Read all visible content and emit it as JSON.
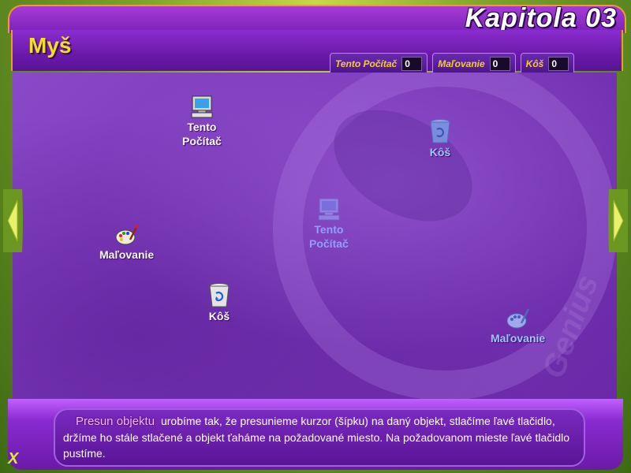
{
  "header": {
    "chapter_title": "Kapitola 03",
    "section_title": "Myš"
  },
  "counters": [
    {
      "label": "Tento Počítač",
      "value": "0"
    },
    {
      "label": "Maľovanie",
      "value": "0"
    },
    {
      "label": "Kôš",
      "value": "0"
    }
  ],
  "workspace": {
    "items": [
      {
        "name": "Tento Počítač",
        "line1": "Tento",
        "line2": "Počítač",
        "icon": "computer-icon"
      },
      {
        "name": "Kôš",
        "label": "Kôš",
        "icon": "recycle-bin-icon"
      },
      {
        "name": "Maľovanie",
        "label": "Maľovanie",
        "icon": "palette-icon"
      },
      {
        "name": "Tento Počítač (target)",
        "line1": "Tento",
        "line2": "Počítač",
        "icon": "computer-icon"
      },
      {
        "name": "Maľovanie",
        "label": "Maľovanie",
        "icon": "palette-icon"
      },
      {
        "name": "Kôš (target)",
        "label": "Kôš",
        "icon": "recycle-bin-icon"
      }
    ],
    "watermark": "Genius"
  },
  "info": {
    "highlight": "Presun objektu",
    "text": "urobíme tak, že presunieme kurzor (šípku) na daný objekt, stlačíme ľavé tlačidlo, držíme ho stále stlačené a objekt ťaháme na požadované miesto. Na požadovanom mieste ľavé tlačidlo pustíme."
  },
  "nav": {
    "close_symbol": "X",
    "icons": [
      "left-arrow-icon",
      "right-arrow-icon"
    ]
  },
  "colors": {
    "title_yellow": "#f2e020",
    "frame_purple": "#7a22b8",
    "frame_green": "#7aa22a"
  }
}
